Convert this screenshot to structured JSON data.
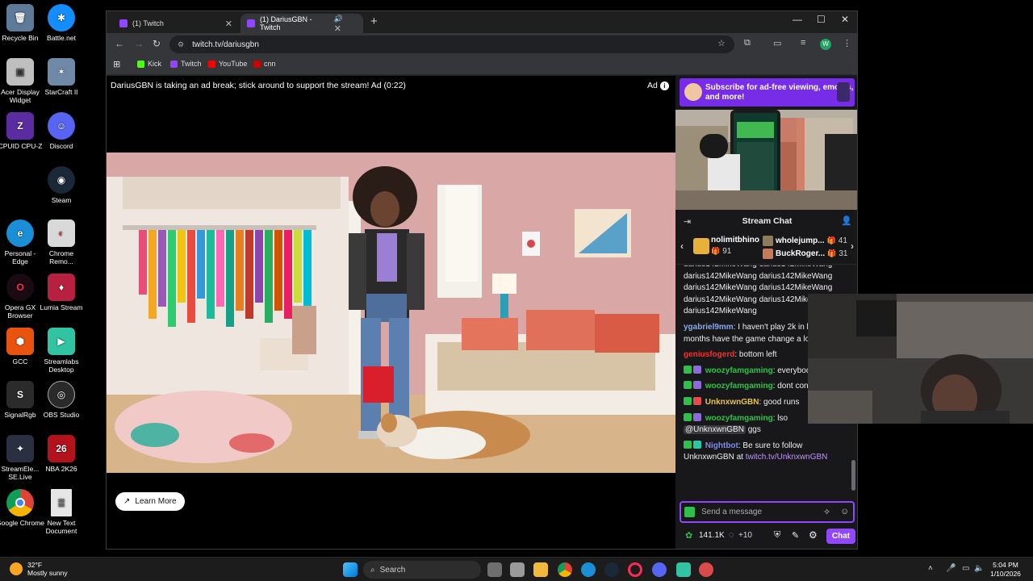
{
  "desktop": {
    "icons": [
      {
        "label": "Recycle Bin",
        "glyph": "🗑",
        "color": "#5d7a99"
      },
      {
        "label": "Battle.net",
        "glyph": "✱",
        "color": "#148eff"
      },
      {
        "label": "Acer Display Widget",
        "glyph": "▣",
        "color": "#bfbfbf"
      },
      {
        "label": "StarCraft II",
        "glyph": "✶",
        "color": "#6f8aa8"
      },
      {
        "label": "CPUID CPU-Z",
        "glyph": "Z",
        "color": "#5b2ca0"
      },
      {
        "label": "Discord",
        "glyph": "☺",
        "color": "#5865f2"
      },
      {
        "label": "Steam",
        "glyph": "◉",
        "color": "#1b2838"
      },
      {
        "label": "Personal - Edge",
        "glyph": "e",
        "color": "#1a8fd6"
      },
      {
        "label": "Chrome Remo...",
        "glyph": "◐",
        "color": "#d9d9d9"
      },
      {
        "label": "Opera GX Browser",
        "glyph": "O",
        "color": "#1a0a12"
      },
      {
        "label": "Lumia Stream",
        "glyph": "♦",
        "color": "#b8203f"
      },
      {
        "label": "GCC",
        "glyph": "⬢",
        "color": "#e8540f"
      },
      {
        "label": "Streamlabs Desktop",
        "glyph": "▶",
        "color": "#31c3a2"
      },
      {
        "label": "SignalRgb",
        "glyph": "S",
        "color": "#2b2b2b"
      },
      {
        "label": "OBS Studio",
        "glyph": "◎",
        "color": "#2a2a2a"
      },
      {
        "label": "StreamEle... SE.Live",
        "glyph": "✦",
        "color": "#2a3042"
      },
      {
        "label": "NBA 2K26",
        "glyph": "26",
        "color": "#b3121d"
      },
      {
        "label": "Google Chrome",
        "glyph": "◉",
        "color": "#2c9c46"
      },
      {
        "label": "New Text Document",
        "glyph": "≣",
        "color": "#e6e6e6"
      }
    ]
  },
  "browser": {
    "tabs": [
      {
        "title": "(1) Twitch"
      },
      {
        "title": "(1) DariusGBN - Twitch"
      }
    ],
    "url": "twitch.tv/dariusgbn",
    "profile_initial": "W",
    "bookmarks": [
      {
        "label": "Kick",
        "color": "#53fc18"
      },
      {
        "label": "Twitch",
        "color": "#9146ff"
      },
      {
        "label": "YouTube",
        "color": "#ff0000"
      },
      {
        "label": "cnn",
        "color": "#cc0000"
      }
    ]
  },
  "player": {
    "ad_banner": "DariusGBN is taking an ad break; stick around to support the stream! Ad (0:22)",
    "ad_label": "Ad",
    "learn_more": "Learn More"
  },
  "chat": {
    "sub_ad": "Subscribe for ad-free viewing, emotes, and more!",
    "title": "Stream Chat",
    "leaderboard": [
      {
        "name": "nolimitbhino",
        "count": "91"
      },
      {
        "name": "wholejump...",
        "count": "41"
      },
      {
        "name": "BuckRoger...",
        "count": "31"
      }
    ],
    "messages": [
      {
        "user": "",
        "text": "darius142MikeWang darius142MikeWang darius142MikeWang darius142MikeWang darius142MikeWang darius142MikeWang darius142MikeWang darius142MikeWang darius142MikeWang",
        "color": "#efeff1"
      },
      {
        "user": "ygabriel9mm",
        "text": ": I haven't play 2k in like 3 months have the game change a lot?",
        "color": "#8aa9f0"
      },
      {
        "user": "geniusfogerd",
        "text": ": bottom left",
        "color": "#ff2a2a"
      },
      {
        "user": "woozyfamgaming",
        "text": ": everybody out there",
        "color": "#2fbf4a"
      },
      {
        "user": "woozyfamgaming",
        "text": ": dont con paint",
        "color": "#2fbf4a"
      },
      {
        "user": "UnknxwnGBN",
        "text": ": good runs",
        "color": "#e8c547"
      },
      {
        "user": "woozyfamgaming",
        "text": ": lso",
        "mention": "@UnknxwnGBN",
        "after": " ggs",
        "color": "#2fbf4a"
      },
      {
        "user": "Nightbot",
        "text": ": Be sure to follow UnknxwnGBN at ",
        "link": "twitch.tv/UnknxwnGBN",
        "color": "#7c8ce0"
      }
    ],
    "input_placeholder": "Send a message",
    "points": "141.1K",
    "bonus": "+10",
    "send_label": "Chat"
  },
  "taskbar": {
    "temp": "32°F",
    "weather": "Mostly sunny",
    "search": "Search",
    "time": "5:04 PM",
    "date": "1/10/2026"
  }
}
